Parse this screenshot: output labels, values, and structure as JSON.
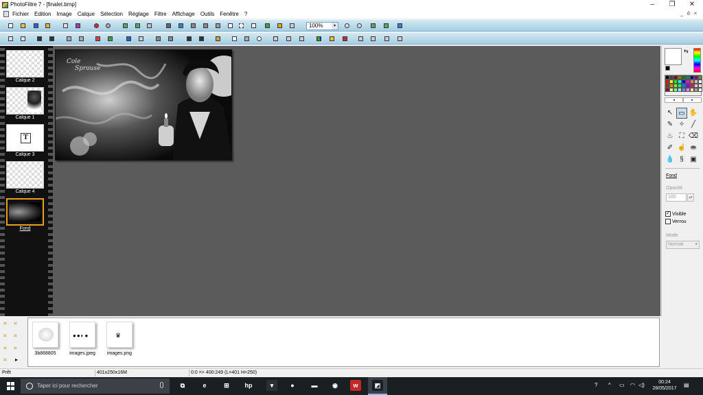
{
  "window": {
    "title": "PhotoFiltre 7 - [finalet.bmp]",
    "minimize_glyph": "–",
    "maximize_glyph": "❐",
    "close_glyph": "✕"
  },
  "menu": {
    "items": [
      "Fichier",
      "Edition",
      "Image",
      "Calque",
      "Sélection",
      "Réglage",
      "Filtre",
      "Affichage",
      "Outils",
      "Fenêtre",
      "?"
    ],
    "mdi_minimize": "_",
    "mdi_restore": "ē",
    "mdi_close": "×"
  },
  "toolbar": {
    "zoom_value": "100%",
    "zoom_arrow": "▾"
  },
  "layers": {
    "items": [
      {
        "label": "Calque 2"
      },
      {
        "label": "Calque 1"
      },
      {
        "label": "Calque 3",
        "text_glyph": "T"
      },
      {
        "label": "Calque 4"
      },
      {
        "label": "Fond",
        "selected": true
      }
    ]
  },
  "canvas": {
    "watermark_line1": "Cole",
    "watermark_line2": "Sprouse"
  },
  "palette": {
    "swap_glyph": "⇆",
    "arrow_left": "◂",
    "arrow_right": "▸",
    "swatch_colors": [
      "#000000",
      "#404040",
      "#800000",
      "#808000",
      "#008000",
      "#008080",
      "#000080",
      "#800080",
      "#808040",
      "#ff0000",
      "#ffff00",
      "#00ff00",
      "#00ffff",
      "#0000ff",
      "#ff00ff",
      "#ff8040",
      "#c0c0c0",
      "#ffffff",
      "#804000",
      "#ff8000",
      "#80ff00",
      "#00ff80",
      "#0080ff",
      "#8000ff",
      "#ff0080",
      "#ffc0c0",
      "#e0e0e0",
      "#800040",
      "#ffff80",
      "#80ff80",
      "#80ffff",
      "#8080ff",
      "#ff80ff",
      "#ffe0a0",
      "#a0a0a0",
      "#f0f0f0"
    ],
    "tools": [
      {
        "name": "pointer-tool-icon",
        "glyph": "↖",
        "active": false
      },
      {
        "name": "selection-tool-icon",
        "glyph": "▭",
        "active": true
      },
      {
        "name": "hand-tool-icon",
        "glyph": "✋",
        "active": false
      },
      {
        "name": "eyedropper-tool-icon",
        "glyph": "✎",
        "active": false
      },
      {
        "name": "magic-wand-tool-icon",
        "glyph": "✧",
        "active": false
      },
      {
        "name": "line-tool-icon",
        "glyph": "╱",
        "active": false
      },
      {
        "name": "fill-tool-icon",
        "glyph": "♨",
        "active": false
      },
      {
        "name": "spray-tool-icon",
        "glyph": "⛶",
        "active": false
      },
      {
        "name": "eraser-tool-icon",
        "glyph": "⌫",
        "active": false
      },
      {
        "name": "brush-tool-icon",
        "glyph": "✐",
        "active": false
      },
      {
        "name": "finger-tool-icon",
        "glyph": "☝",
        "active": false
      },
      {
        "name": "stamp-tool-icon",
        "glyph": "⛂",
        "active": false
      },
      {
        "name": "blur-tool-icon",
        "glyph": "💧",
        "active": false
      },
      {
        "name": "deform-tool-icon",
        "glyph": "§",
        "active": false
      },
      {
        "name": "clone-tool-icon",
        "glyph": "▣",
        "active": false
      }
    ],
    "layer_name": "Fond",
    "opacity_label": "Opacité",
    "opacity_value": "100",
    "opacity_spin": "▴▾",
    "visible_label": "Visible",
    "visible_checked": "✓",
    "lock_label": "Verrou",
    "mode_label": "Mode",
    "mode_value": "Normal",
    "mode_arrow": "▾"
  },
  "browser": {
    "files": [
      {
        "name": "3b868805"
      },
      {
        "name": "images.jpeg"
      },
      {
        "name": "images.png"
      }
    ],
    "side_more": "▸"
  },
  "status": {
    "state": "Prêt",
    "image_info": "401x250x16M",
    "selection_info": "0:0 => 400:249 (L=401  H=250)"
  },
  "taskbar": {
    "search_placeholder": "Taper ici pour rechercher",
    "time": "00:24",
    "date": "28/05/2017",
    "apps": [
      {
        "name": "task-view-icon",
        "glyph": "⧉",
        "bg": "#1a1f24"
      },
      {
        "name": "edge-icon",
        "glyph": "e",
        "bg": "#1a1f24"
      },
      {
        "name": "store-icon",
        "glyph": "⊞",
        "bg": "#1a1f24"
      },
      {
        "name": "hp-icon",
        "glyph": "hp",
        "bg": "#1a1f24"
      },
      {
        "name": "app-dark-icon",
        "glyph": "▾",
        "bg": "#2a2f34"
      },
      {
        "name": "app-yellow-icon",
        "glyph": "●",
        "bg": "#1a1f24"
      },
      {
        "name": "explorer-icon",
        "glyph": "▬",
        "bg": "#1a1f24"
      },
      {
        "name": "chrome-icon",
        "glyph": "◉",
        "bg": "#1a1f24"
      },
      {
        "name": "app-red-icon",
        "glyph": "w",
        "bg": "#c62828"
      },
      {
        "name": "photofiltre-task-icon",
        "glyph": "◩",
        "bg": "#1a1f24"
      }
    ],
    "tray": [
      {
        "name": "help-tray-icon",
        "glyph": "?"
      },
      {
        "name": "chevron-up-icon",
        "glyph": "^"
      },
      {
        "name": "battery-icon",
        "glyph": "▭"
      },
      {
        "name": "network-icon",
        "glyph": "◠"
      },
      {
        "name": "volume-icon",
        "glyph": "◁)"
      },
      {
        "name": "notification-icon",
        "glyph": "▤"
      }
    ]
  }
}
